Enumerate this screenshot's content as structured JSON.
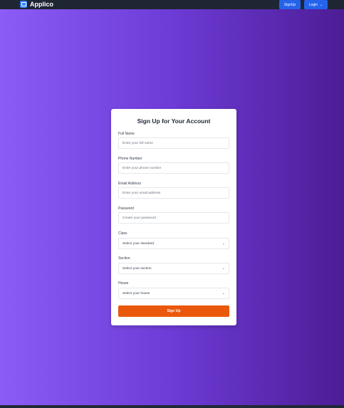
{
  "navbar": {
    "brand": "Applico",
    "signup_label": "SignUp",
    "login_label": "Login",
    "login_chevron": "⌄"
  },
  "form": {
    "title": "Sign Up for Your Account",
    "fields": [
      {
        "label": "Full Name",
        "placeholder": "Enter your full name"
      },
      {
        "label": "Phone Number",
        "placeholder": "Enter your phone number"
      },
      {
        "label": "Email Address",
        "placeholder": "Enter your email address"
      },
      {
        "label": "Password",
        "placeholder": "Create your password"
      }
    ],
    "selects": [
      {
        "label": "Class",
        "value": "Select your standard"
      },
      {
        "label": "Section",
        "value": "Select your section"
      },
      {
        "label": "House",
        "value": "Select your house"
      }
    ],
    "select_chevron": "⌄",
    "submit_label": "Sign Up"
  },
  "colors": {
    "navbar": "#1f2633",
    "primary": "#2563eb",
    "accent": "#ea580c",
    "gradient_start": "#8b5cf6",
    "gradient_end": "#4c1d95"
  }
}
